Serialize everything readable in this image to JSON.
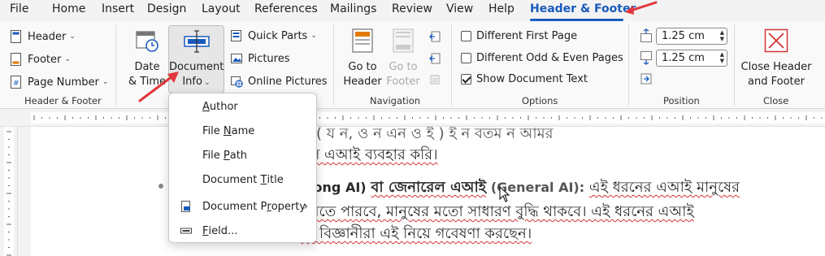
{
  "menu": {
    "tabs": [
      "File",
      "Home",
      "Insert",
      "Design",
      "Layout",
      "References",
      "Mailings",
      "Review",
      "View",
      "Help",
      "Header & Footer"
    ],
    "active_tab": "Header & Footer"
  },
  "ribbon": {
    "header_footer_group": {
      "header": "Header",
      "footer": "Footer",
      "page_number": "Page Number",
      "label": "Header & Footer"
    },
    "insert_group": {
      "date_time_line1": "Date",
      "date_time_line2": "& Time",
      "document_info_line1": "Document",
      "document_info_line2": "Info",
      "quick_parts": "Quick Parts",
      "pictures": "Pictures",
      "online_pictures": "Online Pictures"
    },
    "navigation_group": {
      "go_to_header_line1": "Go to",
      "go_to_header_line2": "Header",
      "go_to_footer_line1": "Go to",
      "go_to_footer_line2": "Footer",
      "label": "Navigation"
    },
    "options_group": {
      "different_first_page": "Different First Page",
      "different_odd_even": "Different Odd & Even Pages",
      "show_document_text": "Show Document Text",
      "different_first_page_checked": false,
      "different_odd_even_checked": false,
      "show_document_text_checked": true,
      "label": "Options"
    },
    "position_group": {
      "header_from_top": "1.25 cm",
      "footer_from_bottom": "1.25 cm",
      "label": "Position"
    },
    "close_group": {
      "close_line1": "Close Header",
      "close_line2": "and Footer",
      "label": "Close"
    }
  },
  "document_info_menu": {
    "author_pre": "",
    "author_key": "A",
    "author_post": "uthor",
    "file_name_pre": "File ",
    "file_name_key": "N",
    "file_name_post": "ame",
    "file_path_pre": "File ",
    "file_path_key": "P",
    "file_path_post": "ath",
    "document_title_pre": "Document ",
    "document_title_key": "T",
    "document_title_post": "itle",
    "document_property_pre": "Document P",
    "document_property_key": "r",
    "document_property_post": "operty",
    "field_pre": "",
    "field_key": "F",
    "field_post": "ield..."
  },
  "document": {
    "line1": "ও ( য ন, ও ন এন ও ই ) ই ন বতম ন আমর",
    "line2": "র্বল এআই ব্যবহার করি।",
    "line3_bold_en": "trong AI)",
    "line3_bold_bn": "বা জেনারেল এআই",
    "line3_en": "(General AI):",
    "line3_rest": "এই ধরনের এআই মানুষের",
    "line4": "করতে পারবে, মানুষের মতো সাধারণ বুদ্ধি থাকবে। এই ধরনের এআই",
    "line5": "বে বিজ্ঞানীরা এই নিয়ে গবেষণা করছেন।"
  },
  "colors": {
    "accent": "#185abd",
    "annotation_arrow": "#e0363b",
    "close_icon": "#d13438"
  }
}
